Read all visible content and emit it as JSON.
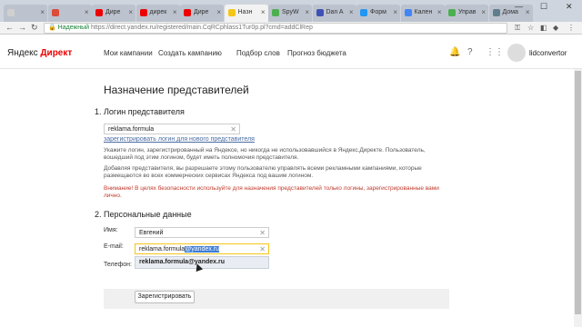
{
  "tabs": [
    {
      "label": "",
      "color": "#d0d0d0"
    },
    {
      "label": "",
      "color": "#dd4b39"
    },
    {
      "label": "Дире",
      "color": "#e00"
    },
    {
      "label": "дирек",
      "color": "#e00"
    },
    {
      "label": "Дире",
      "color": "#e00"
    },
    {
      "label": "Назн",
      "color": "#f5c518",
      "active": true
    },
    {
      "label": "SpyW",
      "color": "#4caf50"
    },
    {
      "label": "Dan A",
      "color": "#3f51b5"
    },
    {
      "label": "Форм",
      "color": "#2196f3"
    },
    {
      "label": "Кален",
      "color": "#4285f4"
    },
    {
      "label": "Управ",
      "color": "#4caf50"
    },
    {
      "label": "Дома",
      "color": "#607d8b"
    }
  ],
  "window": {
    "minimize": "—",
    "maximize": "☐",
    "close": "✕"
  },
  "browser": {
    "secure_label": "Надежный",
    "url": "https://direct.yandex.ru/registered/main.CqRCphlass1Tur0p.pl?cmd=addClRep"
  },
  "header": {
    "logo_a": "Яндекс",
    "logo_b": "Директ",
    "nav": [
      "Мои кампании",
      "Создать кампанию",
      "Подбор слов",
      "Прогноз бюджета"
    ],
    "username": "lidconvertor"
  },
  "page": {
    "title": "Назначение представителей",
    "section1": "1. Логин представителя",
    "login_value": "reklama.formula",
    "register_link": "зарегистрировать логин для нового представителя",
    "info1": "Укажите логин, зарегистрированный на Яндексе, но никогда не использовавшийся в Яндекс.Директе. Пользователь, вошедший под этим логином, будет иметь полномочия представителя.",
    "info2": "Добавляя представителя, вы разрешаете этому пользователю управлять всеми рекламными кампаниями, которые размещаются во всех коммерческих сервисах Яндекса под вашим логином.",
    "warning": "Внимание! В целях безопасности используйте для назначения представителей только логины, зарегистрированные вами лично.",
    "section2": "2. Персональные данные",
    "name_label": "Имя:",
    "name_value": "Евгений",
    "email_label": "E-mail:",
    "email_value_pre": "reklama.formula",
    "email_value_sel": "@yandex.ru",
    "suggestion": "reklama.formula@yandex.ru",
    "phone_label": "Телефон:",
    "submit": "Зарегистрировать"
  }
}
